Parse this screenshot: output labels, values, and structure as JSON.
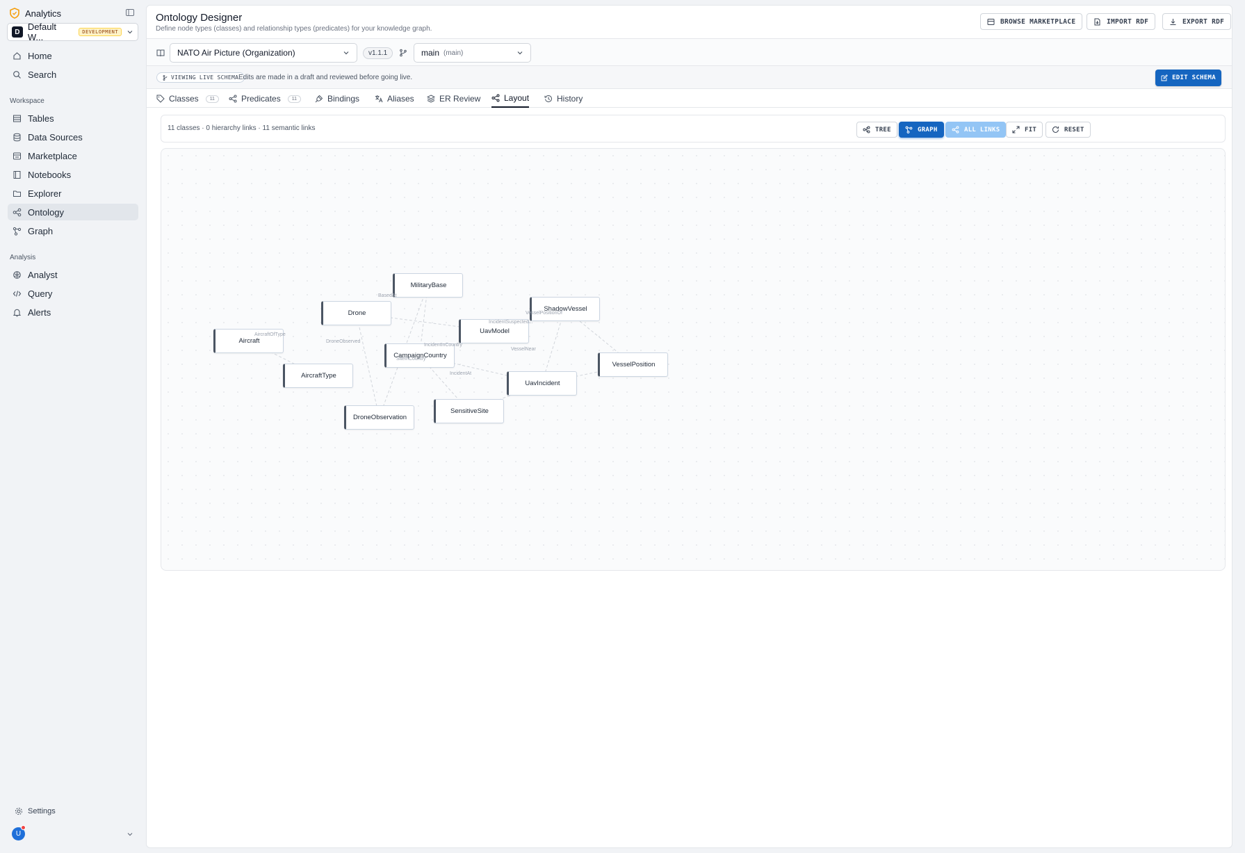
{
  "sidebar": {
    "app_name": "Analytics",
    "workspace": {
      "avatar": "D",
      "name": "Default W...",
      "badge": "DEVELOPMENT"
    },
    "top_items": [
      {
        "label": "Home"
      },
      {
        "label": "Search"
      }
    ],
    "sections": [
      {
        "title": "Workspace",
        "items": [
          {
            "label": "Tables"
          },
          {
            "label": "Data Sources"
          },
          {
            "label": "Marketplace"
          },
          {
            "label": "Notebooks"
          },
          {
            "label": "Explorer"
          },
          {
            "label": "Ontology",
            "active": true
          },
          {
            "label": "Graph"
          }
        ]
      },
      {
        "title": "Analysis",
        "items": [
          {
            "label": "Analyst"
          },
          {
            "label": "Query"
          },
          {
            "label": "Alerts"
          }
        ]
      }
    ],
    "settings_label": "Settings",
    "user_initial": "U"
  },
  "header": {
    "title": "Ontology Designer",
    "subtitle": "Define node types (classes) and relationship types (predicates) for your knowledge graph.",
    "buttons": {
      "marketplace": "BROWSE MARKETPLACE",
      "import": "IMPORT RDF",
      "export": "EXPORT RDF"
    }
  },
  "toolbar": {
    "ontology": "NATO Air Picture (Organization)",
    "version": "v1.1.1",
    "branch": "main",
    "branch_sub": "(main)"
  },
  "schema_bar": {
    "status": "VIEWING LIVE SCHEMA",
    "note": "Edits are made in a draft and reviewed before going live.",
    "edit_button": "EDIT SCHEMA"
  },
  "tabs": [
    {
      "label": "Classes",
      "count": "11"
    },
    {
      "label": "Predicates",
      "count": "11"
    },
    {
      "label": "Bindings"
    },
    {
      "label": "Aliases"
    },
    {
      "label": "ER Review"
    },
    {
      "label": "Layout",
      "active": true
    },
    {
      "label": "History"
    }
  ],
  "graph": {
    "stats": "11 classes · 0 hierarchy links · 11 semantic links",
    "buttons": {
      "tree": "TREE",
      "graph": "GRAPH",
      "all_links": "ALL LINKS",
      "fit": "FIT",
      "reset": "RESET"
    },
    "nodes": [
      {
        "label": "MilitaryBase"
      },
      {
        "label": "Drone"
      },
      {
        "label": "UavModel"
      },
      {
        "label": "ShadowVessel"
      },
      {
        "label": "Aircraft"
      },
      {
        "label": "CampaignCountry"
      },
      {
        "label": "VesselPosition"
      },
      {
        "label": "AircraftType"
      },
      {
        "label": "UavIncident"
      },
      {
        "label": "SensitiveSite"
      },
      {
        "label": "DroneObservation"
      }
    ],
    "edge_labels": [
      "BasedAt",
      "AircraftOfType",
      "DroneObserved",
      "IncidentInCountry",
      "SiteInCountry",
      "IncidentSuspected...",
      "VesselPositionOf",
      "VesselNear",
      "IncidentAt"
    ]
  }
}
